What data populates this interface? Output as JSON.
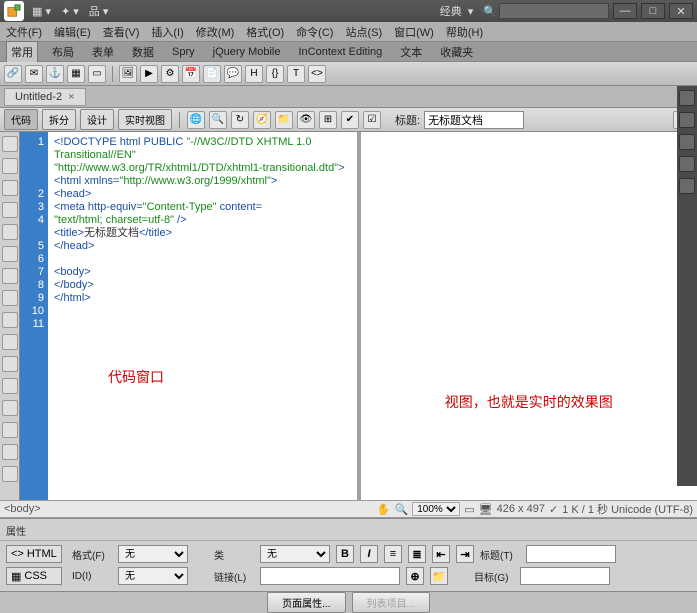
{
  "title": {
    "workspace": "经典"
  },
  "menus": [
    "文件(F)",
    "编辑(E)",
    "查看(V)",
    "插入(I)",
    "修改(M)",
    "格式(O)",
    "命令(C)",
    "站点(S)",
    "窗口(W)",
    "帮助(H)"
  ],
  "tabstrip": [
    "常用",
    "布局",
    "表单",
    "数据",
    "Spry",
    "jQuery Mobile",
    "InContext Editing",
    "文本",
    "收藏夹"
  ],
  "doc": {
    "tab": "Untitled-2",
    "titlelabel": "标题:",
    "titlevalue": "无标题文档"
  },
  "viewbtns": {
    "code": "代码",
    "split": "拆分",
    "design": "设计",
    "live": "实时视图"
  },
  "code": {
    "lines": [
      "1",
      "2",
      "3",
      "4",
      "5",
      "6",
      "7",
      "8",
      "9",
      "10",
      "11"
    ],
    "l1a": "<!DOCTYPE html PUBLIC ",
    "l1b": "\"-//W3C//DTD XHTML 1.0 Transitional//EN\"",
    "l1c": "\"http://www.w3.org/TR/xhtml1/DTD/xhtml1-transitional.dtd\"",
    "l1d": ">",
    "l2a": "<html xmlns=",
    "l2b": "\"http://www.w3.org/1999/xhtml\"",
    "l2c": ">",
    "l3": "<head>",
    "l4a": "<meta http-equiv=",
    "l4b": "\"Content-Type\"",
    "l4c": " content=",
    "l4d": "\"text/html; charset=utf-8\"",
    "l4e": " />",
    "l5a": "<title>",
    "l5b": "无标题文档",
    "l5c": "</title>",
    "l6": "</head>",
    "l8": "<body>",
    "l9": "</body>",
    "l10": "</html>"
  },
  "annotations": {
    "code": "代码窗口",
    "preview": "视图，也就是实时的效果图"
  },
  "tagbar": {
    "tag": "<body>",
    "zoom": "100%",
    "dims": "426 x 497",
    "stats": "1 K / 1 秒 Unicode (UTF-8)"
  },
  "props": {
    "title": "属性",
    "mode_html": "HTML",
    "mode_css": "CSS",
    "format_lbl": "格式(F)",
    "format_val": "无",
    "class_lbl": "类",
    "class_val": "无",
    "id_lbl": "ID(I)",
    "id_val": "无",
    "link_lbl": "链接(L)",
    "title_lbl": "标题(T)",
    "target_lbl": "目标(G)",
    "pageprops": "页面属性...",
    "listitem": "列表项目..."
  }
}
